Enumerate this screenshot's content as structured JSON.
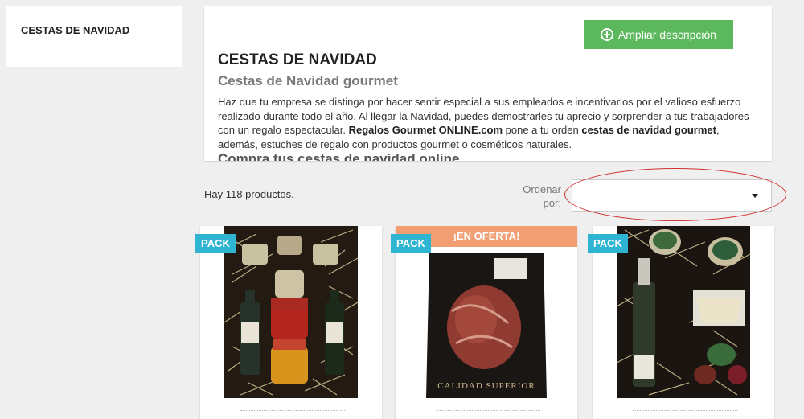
{
  "sidebar": {
    "title": "CESTAS DE NAVIDAD"
  },
  "category": {
    "expand_button": "Ampliar descripción",
    "title": "CESTAS DE NAVIDAD",
    "subtitle": "Cestas de Navidad gourmet",
    "text_1": "Haz que tu empresa se distinga por hacer sentir especial a sus empleados e incentivarlos por el valioso esfuerzo realizado durante todo el año. Al llegar la Navidad,  puedes demostrarles tu aprecio y sorprender a tus trabajadores con un regalo espectacular. ",
    "text_bold_1": "Regalos Gourmet ONLINE.com",
    "text_2": " pone a tu orden ",
    "text_bold_2": "cestas de navidad gourmet",
    "text_3": ", además, estuches de regalo con productos gourmet o cosméticos naturales.",
    "heading_2": "Compra tus cestas de navidad online"
  },
  "listing": {
    "count_text": "Hay 118 productos.",
    "sort_label": "Ordenar por:",
    "sort_value": ""
  },
  "products": [
    {
      "flag": "PACK",
      "offer": ""
    },
    {
      "flag": "PACK",
      "offer": "¡EN OFERTA!"
    },
    {
      "flag": "PACK",
      "offer": ""
    }
  ],
  "colors": {
    "expand_button": "#5cb85c",
    "pack_flag": "#2fb5d2",
    "offer_flag": "#f39d72",
    "highlight": "#d0302f"
  }
}
